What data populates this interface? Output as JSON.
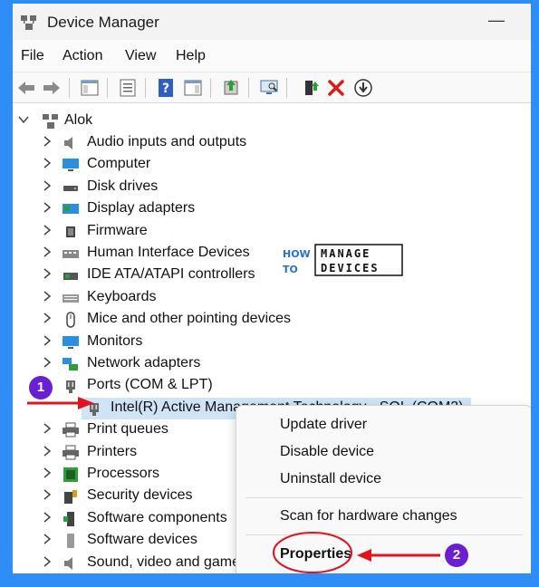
{
  "window": {
    "title": "Device Manager",
    "minimize_glyph": "—"
  },
  "menu": [
    "File",
    "Action",
    "View",
    "Help"
  ],
  "tree": {
    "root": "Alok",
    "items": [
      {
        "label": "Audio inputs and outputs",
        "icon": "speaker-icon"
      },
      {
        "label": "Computer",
        "icon": "monitor-icon"
      },
      {
        "label": "Disk drives",
        "icon": "disk-icon"
      },
      {
        "label": "Display adapters",
        "icon": "display-adapter-icon"
      },
      {
        "label": "Firmware",
        "icon": "chip-icon"
      },
      {
        "label": "Human Interface Devices",
        "icon": "hid-icon"
      },
      {
        "label": "IDE ATA/ATAPI controllers",
        "icon": "controller-icon"
      },
      {
        "label": "Keyboards",
        "icon": "keyboard-icon"
      },
      {
        "label": "Mice and other pointing devices",
        "icon": "mouse-icon"
      },
      {
        "label": "Monitors",
        "icon": "monitor-icon"
      },
      {
        "label": "Network adapters",
        "icon": "network-icon"
      },
      {
        "label": "Ports (COM & LPT)",
        "icon": "port-icon"
      },
      {
        "label": "Intel(R) Active Management Technology - SOL (COM3)",
        "icon": "port-icon"
      },
      {
        "label": "Print queues",
        "icon": "printer-icon"
      },
      {
        "label": "Printers",
        "icon": "printer-icon"
      },
      {
        "label": "Processors",
        "icon": "processor-icon"
      },
      {
        "label": "Security devices",
        "icon": "security-icon"
      },
      {
        "label": "Software components",
        "icon": "software-component-icon"
      },
      {
        "label": "Software devices",
        "icon": "software-device-icon"
      },
      {
        "label": "Sound, video and game controllers",
        "icon": "speaker-icon"
      }
    ]
  },
  "context_menu": {
    "update": "Update driver",
    "disable": "Disable device",
    "uninstall": "Uninstall device",
    "scan": "Scan for hardware changes",
    "properties": "Properties"
  },
  "annotations": {
    "step1": "1",
    "step2": "2"
  },
  "logo": {
    "line1a": "HOW",
    "line1b": "MANAGE",
    "line2a": "TO",
    "line2b": "DEVICES"
  },
  "colors": {
    "frame": "#2e8ef6",
    "annotation": "#e0141e",
    "badge": "#6a1fd1",
    "selection": "#cfe4f7"
  }
}
